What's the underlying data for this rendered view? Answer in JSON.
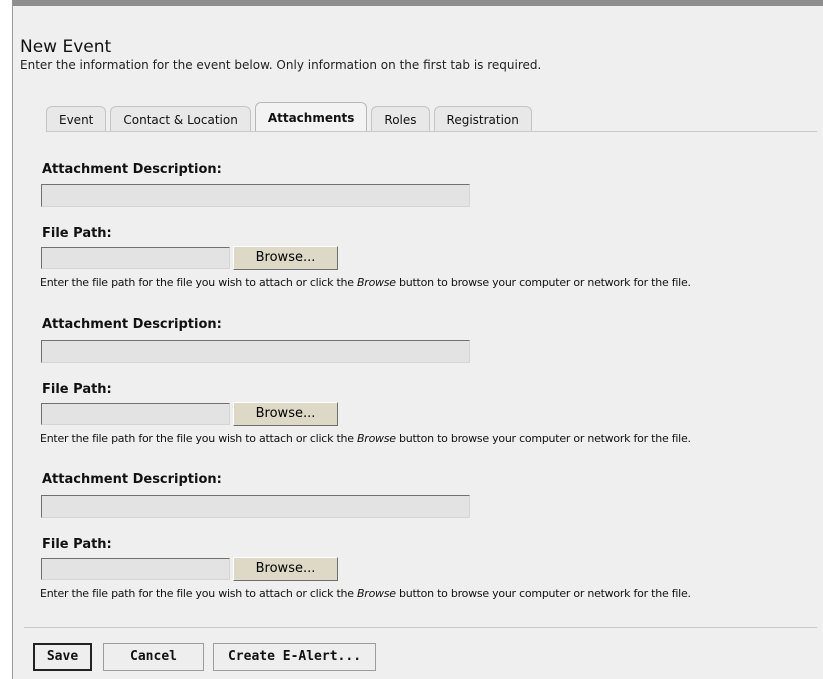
{
  "page": {
    "title": "New Event",
    "subtitle": "Enter the information for the event below. Only information on the first tab is required."
  },
  "tabs": [
    {
      "label": "Event"
    },
    {
      "label": "Contact & Location"
    },
    {
      "label": "Attachments",
      "active": true
    },
    {
      "label": "Roles"
    },
    {
      "label": "Registration"
    }
  ],
  "attachments": [
    {
      "description_label": "Attachment Description:",
      "description_value": "",
      "file_path_label": "File Path:",
      "file_path_value": "",
      "browse_label": "Browse...",
      "help_prefix": "Enter the file path for the file you wish to attach or click the ",
      "help_em": "Browse",
      "help_suffix": " button to browse your computer or network for the file."
    },
    {
      "description_label": "Attachment Description:",
      "description_value": "",
      "file_path_label": "File Path:",
      "file_path_value": "",
      "browse_label": "Browse...",
      "help_prefix": "Enter the file path for the file you wish to attach or click the ",
      "help_em": "Browse",
      "help_suffix": " button to browse your computer or network for the file."
    },
    {
      "description_label": "Attachment Description:",
      "description_value": "",
      "file_path_label": "File Path:",
      "file_path_value": "",
      "browse_label": "Browse...",
      "help_prefix": "Enter the file path for the file you wish to attach or click the ",
      "help_em": "Browse",
      "help_suffix": " button to browse your computer or network for the file."
    }
  ],
  "actions": {
    "save": "Save",
    "cancel": "Cancel",
    "create_alert": "Create E-Alert..."
  }
}
